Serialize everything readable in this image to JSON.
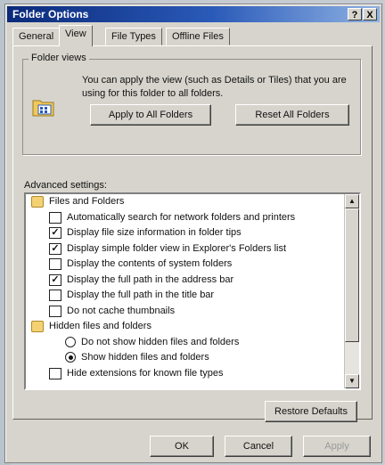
{
  "window": {
    "title": "Folder Options",
    "help_glyph": "?",
    "close_glyph": "X"
  },
  "tabs": [
    {
      "label": "General",
      "active": false
    },
    {
      "label": "View",
      "active": true
    },
    {
      "label": "File Types",
      "active": false
    },
    {
      "label": "Offline Files",
      "active": false
    }
  ],
  "folder_views": {
    "legend": "Folder views",
    "description": "You can apply the view (such as Details or Tiles) that you are using for this folder to all folders.",
    "apply_all_label": "Apply to All Folders",
    "reset_all_label": "Reset All Folders"
  },
  "advanced": {
    "label": "Advanced settings:",
    "items": [
      {
        "type": "folder",
        "label": "Files and Folders"
      },
      {
        "type": "checkbox",
        "checked": false,
        "label": "Automatically search for network folders and printers"
      },
      {
        "type": "checkbox",
        "checked": true,
        "label": "Display file size information in folder tips"
      },
      {
        "type": "checkbox",
        "checked": true,
        "label": "Display simple folder view in Explorer's Folders list"
      },
      {
        "type": "checkbox",
        "checked": false,
        "label": "Display the contents of system folders"
      },
      {
        "type": "checkbox",
        "checked": true,
        "label": "Display the full path in the address bar"
      },
      {
        "type": "checkbox",
        "checked": false,
        "label": "Display the full path in the title bar"
      },
      {
        "type": "checkbox",
        "checked": false,
        "label": "Do not cache thumbnails"
      },
      {
        "type": "folder",
        "label": "Hidden files and folders"
      },
      {
        "type": "radio",
        "checked": false,
        "label": "Do not show hidden files and folders"
      },
      {
        "type": "radio",
        "checked": true,
        "label": "Show hidden files and folders"
      },
      {
        "type": "checkbox",
        "checked": false,
        "label": "Hide extensions for known file types"
      }
    ],
    "scroll_up_glyph": "▲",
    "scroll_down_glyph": "▼",
    "restore_label": "Restore Defaults"
  },
  "footer": {
    "ok_label": "OK",
    "cancel_label": "Cancel",
    "apply_label": "Apply"
  }
}
